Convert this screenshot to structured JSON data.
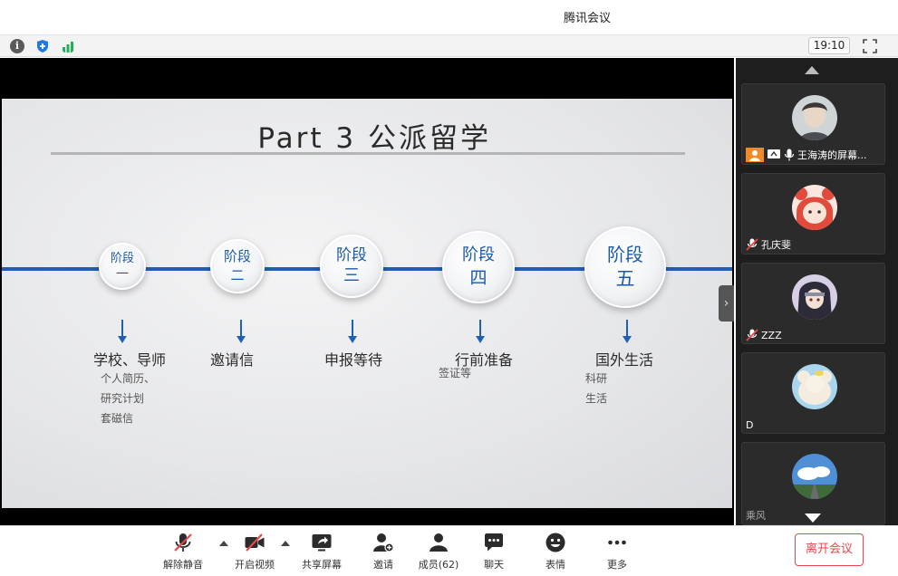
{
  "window": {
    "title": "腾讯会议"
  },
  "status": {
    "time": "19:10"
  },
  "slide": {
    "title": "Part 3 公派留学",
    "stages": [
      {
        "label": "阶段",
        "num": "一",
        "title": "学校、导师",
        "details": [
          "个人简历、",
          "研究计划",
          "套磁信"
        ]
      },
      {
        "label": "阶段",
        "num": "二",
        "title": "邀请信",
        "details": []
      },
      {
        "label": "阶段",
        "num": "三",
        "title": "申报等待",
        "details": []
      },
      {
        "label": "阶段",
        "num": "四",
        "title": "行前准备",
        "details": [
          "签证等"
        ]
      },
      {
        "label": "阶段",
        "num": "五",
        "title": "国外生活",
        "details": [
          "科研",
          "生活"
        ]
      }
    ]
  },
  "participants": [
    {
      "name": "王海涛的屏幕...",
      "avatar": "man-portrait"
    },
    {
      "name": "孔庆斐",
      "avatar": "red-bear-hood"
    },
    {
      "name": "ZZZ",
      "avatar": "anime-character"
    },
    {
      "name": "D",
      "avatar": "plush-toy"
    },
    {
      "name": "乘风",
      "avatar": "sky-road"
    }
  ],
  "toolbar": {
    "unmute": "解除静音",
    "video": "开启视频",
    "share": "共享屏幕",
    "invite": "邀请",
    "members": "成员(62)",
    "chat": "聊天",
    "emoji": "表情",
    "more": "更多",
    "leave": "离开会议"
  },
  "colors": {
    "accent_blue": "#1f5fb5",
    "danger_red": "#e8464a",
    "panel_dark": "#1e1e1e"
  }
}
